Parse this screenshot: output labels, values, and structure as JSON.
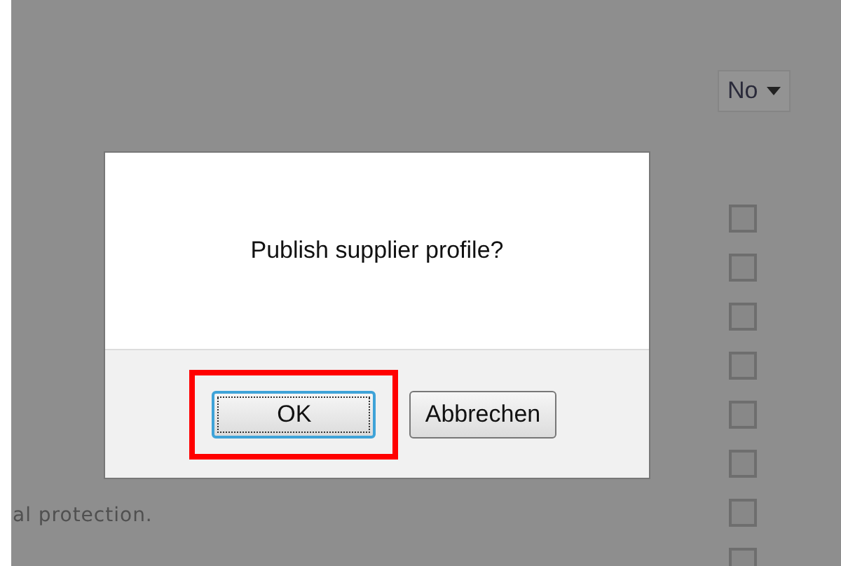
{
  "background_page": {
    "dropdown": {
      "value": "No"
    },
    "checkboxes": [
      {
        "checked": false
      },
      {
        "checked": false
      },
      {
        "checked": false
      },
      {
        "checked": false
      },
      {
        "checked": false
      },
      {
        "checked": false
      },
      {
        "checked": false
      },
      {
        "checked": false
      }
    ],
    "text_fragment": "al protection."
  },
  "dialog": {
    "message": "Publish supplier profile?",
    "buttons": [
      {
        "label": "OK",
        "focused": true,
        "highlighted": true
      },
      {
        "label": "Abbrechen",
        "focused": false,
        "highlighted": false
      }
    ]
  }
}
